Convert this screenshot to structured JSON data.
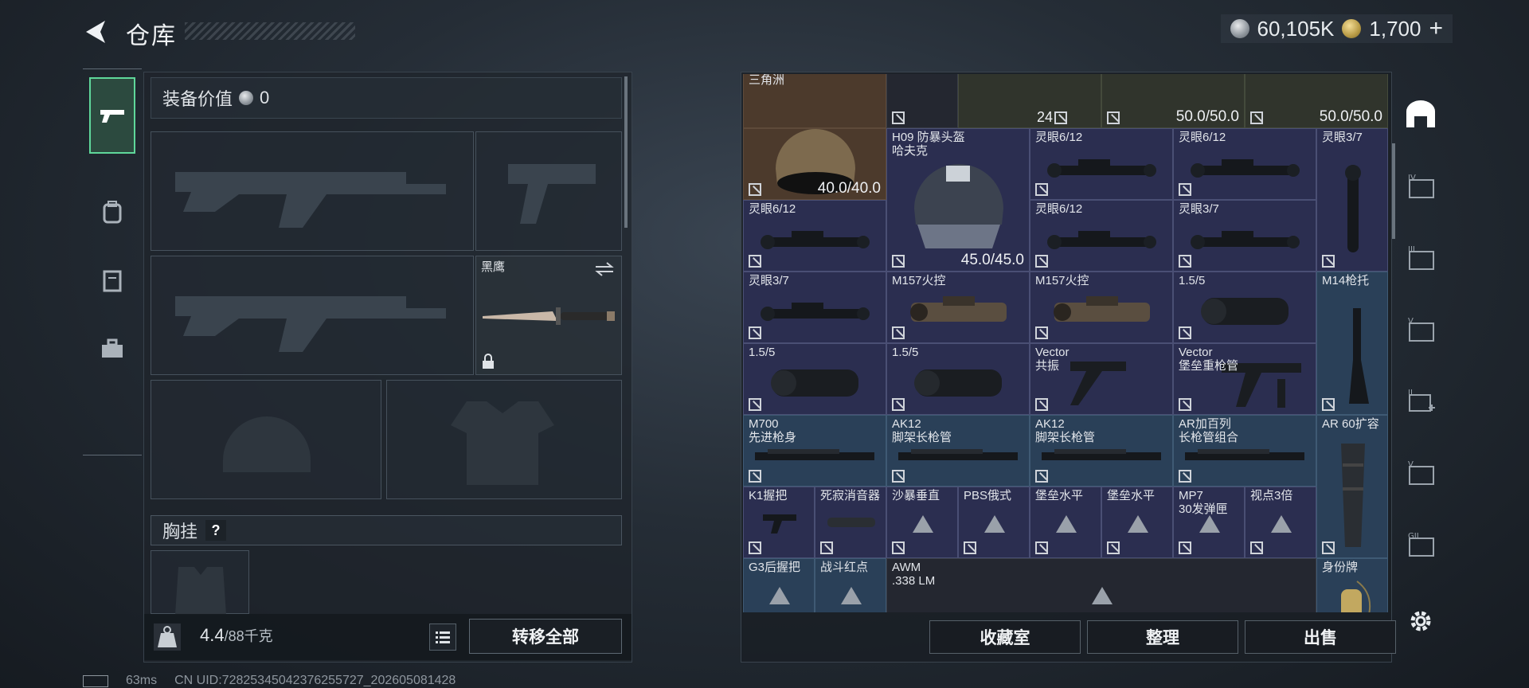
{
  "header": {
    "title": "仓库"
  },
  "currency": {
    "silver": "60,105K",
    "gold": "1,700",
    "gold_plus": "+"
  },
  "left_tabs": [
    {
      "name": "pistol-tab"
    },
    {
      "name": "backpack-tab"
    },
    {
      "name": "vest-tab"
    },
    {
      "name": "toolbox-tab"
    }
  ],
  "equipment": {
    "value_label": "装备价值",
    "value": "0",
    "knife_label": "黑鹰",
    "chest_label": "胸挂",
    "help": "?",
    "weight_current": "4.4",
    "weight_max": "/88千克",
    "transfer_label": "转移全部"
  },
  "status": {
    "ping": "63ms",
    "uid": "CN UID:72825345042376255727_202605081428"
  },
  "warehouse": {
    "top_row": {
      "label": "三角洲",
      "count": "24",
      "dur1": "50.0/50.0",
      "dur2": "50.0/50.0"
    },
    "items": [
      {
        "id": "helmet1",
        "name": "",
        "dur": "40.0/40.0"
      },
      {
        "id": "h09",
        "name": "H09 防暴头盔\n哈夫克",
        "dur": "45.0/45.0"
      },
      {
        "id": "s1",
        "name": "灵眼6/12"
      },
      {
        "id": "s2",
        "name": "灵眼6/12"
      },
      {
        "id": "s3",
        "name": "灵眼3/7"
      },
      {
        "id": "s4",
        "name": "灵眼6/12"
      },
      {
        "id": "s5",
        "name": "灵眼6/12"
      },
      {
        "id": "s6",
        "name": "灵眼3/7"
      },
      {
        "id": "s7",
        "name": "灵眼3/7"
      },
      {
        "id": "s8",
        "name": "M157火控"
      },
      {
        "id": "s9",
        "name": "M157火控"
      },
      {
        "id": "s10",
        "name": "1.5/5"
      },
      {
        "id": "m14",
        "name": "M14枪托"
      },
      {
        "id": "s11",
        "name": "1.5/5"
      },
      {
        "id": "s12",
        "name": "1.5/5"
      },
      {
        "id": "v1",
        "name": "Vector\n共振"
      },
      {
        "id": "v2",
        "name": "Vector\n堡垒重枪管"
      },
      {
        "id": "b1",
        "name": "M700\n先进枪身"
      },
      {
        "id": "b2",
        "name": "AK12\n脚架长枪管"
      },
      {
        "id": "b3",
        "name": "AK12\n脚架长枪管"
      },
      {
        "id": "b4",
        "name": "AR加百列\n长枪管组合"
      },
      {
        "id": "ar60",
        "name": "AR 60扩容"
      },
      {
        "id": "k1",
        "name": "K1握把"
      },
      {
        "id": "k2",
        "name": "死寂消音器"
      },
      {
        "id": "k3",
        "name": "沙暴垂直"
      },
      {
        "id": "k4",
        "name": "PBS俄式"
      },
      {
        "id": "k5",
        "name": "堡垒水平"
      },
      {
        "id": "k6",
        "name": "堡垒水平"
      },
      {
        "id": "k7",
        "name": "MP7\n30发弹匣"
      },
      {
        "id": "k8",
        "name": "视点3倍"
      },
      {
        "id": "g1",
        "name": "G3后握把"
      },
      {
        "id": "g2",
        "name": "战斗红点"
      },
      {
        "id": "awm",
        "name": "AWM\n.338 LM"
      },
      {
        "id": "tag",
        "name": "身份牌"
      }
    ],
    "buttons": {
      "collection": "收藏室",
      "sort": "整理",
      "sell": "出售"
    }
  },
  "right_tabs": [
    "main-tab",
    "tab-iv",
    "tab-iii",
    "tab-v1",
    "tab-ii",
    "tab-v2",
    "tab-g"
  ],
  "colors": {
    "accent_green": "#5fd79a",
    "grid_cell": "#2b2e50",
    "grid_blue": "#2a4058"
  }
}
